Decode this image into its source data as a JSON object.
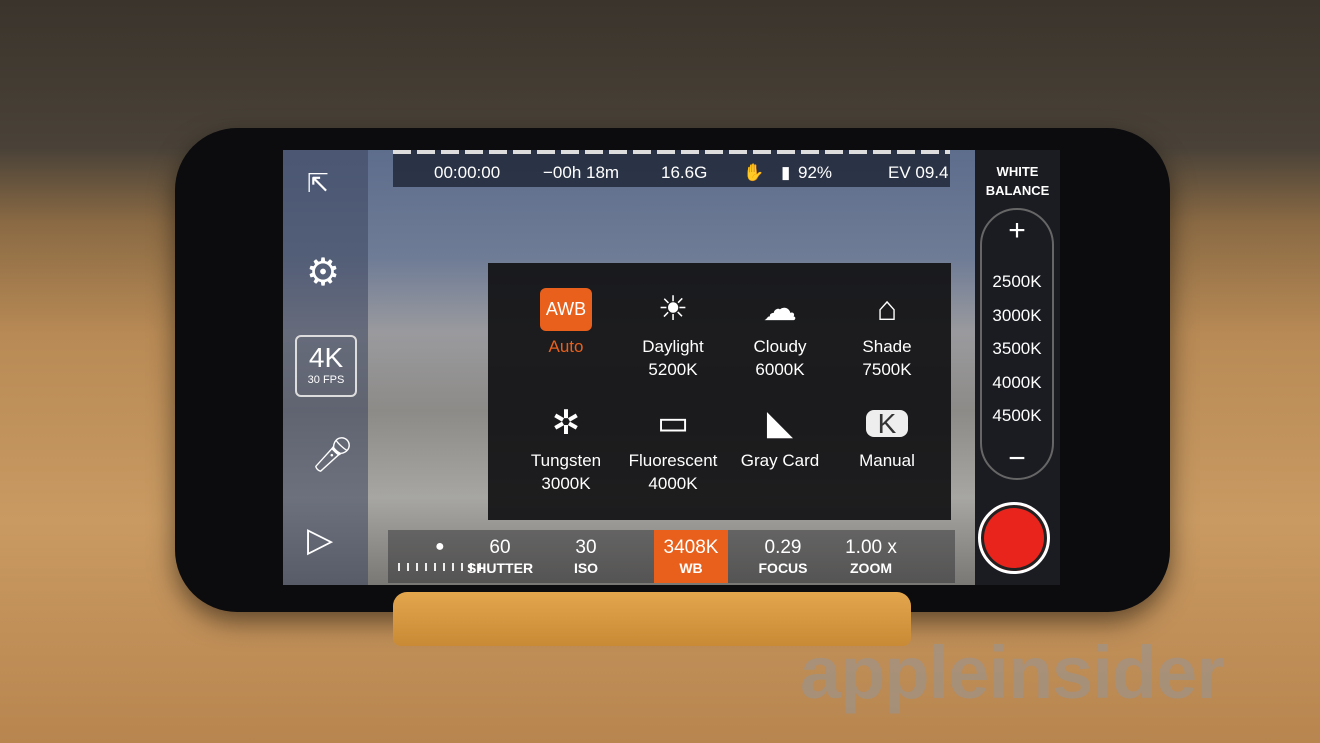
{
  "status": {
    "timecode": "00:00:00",
    "remaining": "−00h 18m",
    "storage": "16.6G",
    "battery": "92%",
    "ev": "EV 09.4"
  },
  "left": {
    "resolution": "4K",
    "fps": "30 FPS"
  },
  "right": {
    "title_line1": "WHITE",
    "title_line2": "BALANCE",
    "plus": "+",
    "minus": "−",
    "temps": [
      "2500K",
      "3000K",
      "3500K",
      "4000K",
      "4500K"
    ]
  },
  "presets": [
    {
      "label": "Auto",
      "temp": "",
      "icon": "AWB",
      "selected": true
    },
    {
      "label": "Daylight",
      "temp": "5200K",
      "icon": "☀"
    },
    {
      "label": "Cloudy",
      "temp": "6000K",
      "icon": "☁"
    },
    {
      "label": "Shade",
      "temp": "7500K",
      "icon": "⌂"
    },
    {
      "label": "Tungsten",
      "temp": "3000K",
      "icon": "✲"
    },
    {
      "label": "Fluorescent",
      "temp": "4000K",
      "icon": "▭"
    },
    {
      "label": "Gray Card",
      "temp": "",
      "icon": "◣"
    },
    {
      "label": "Manual",
      "temp": "",
      "icon": "K"
    }
  ],
  "bottom": [
    {
      "value": "60",
      "label": "SHUTTER"
    },
    {
      "value": "30",
      "label": "ISO"
    },
    {
      "value": "3408K",
      "label": "WB",
      "active": true
    },
    {
      "value": "0.29",
      "label": "FOCUS"
    },
    {
      "value": "1.00 x",
      "label": "ZOOM"
    }
  ],
  "colors": {
    "accent": "#e8601c",
    "record": "#e8241c"
  },
  "watermark": "appleinsider"
}
